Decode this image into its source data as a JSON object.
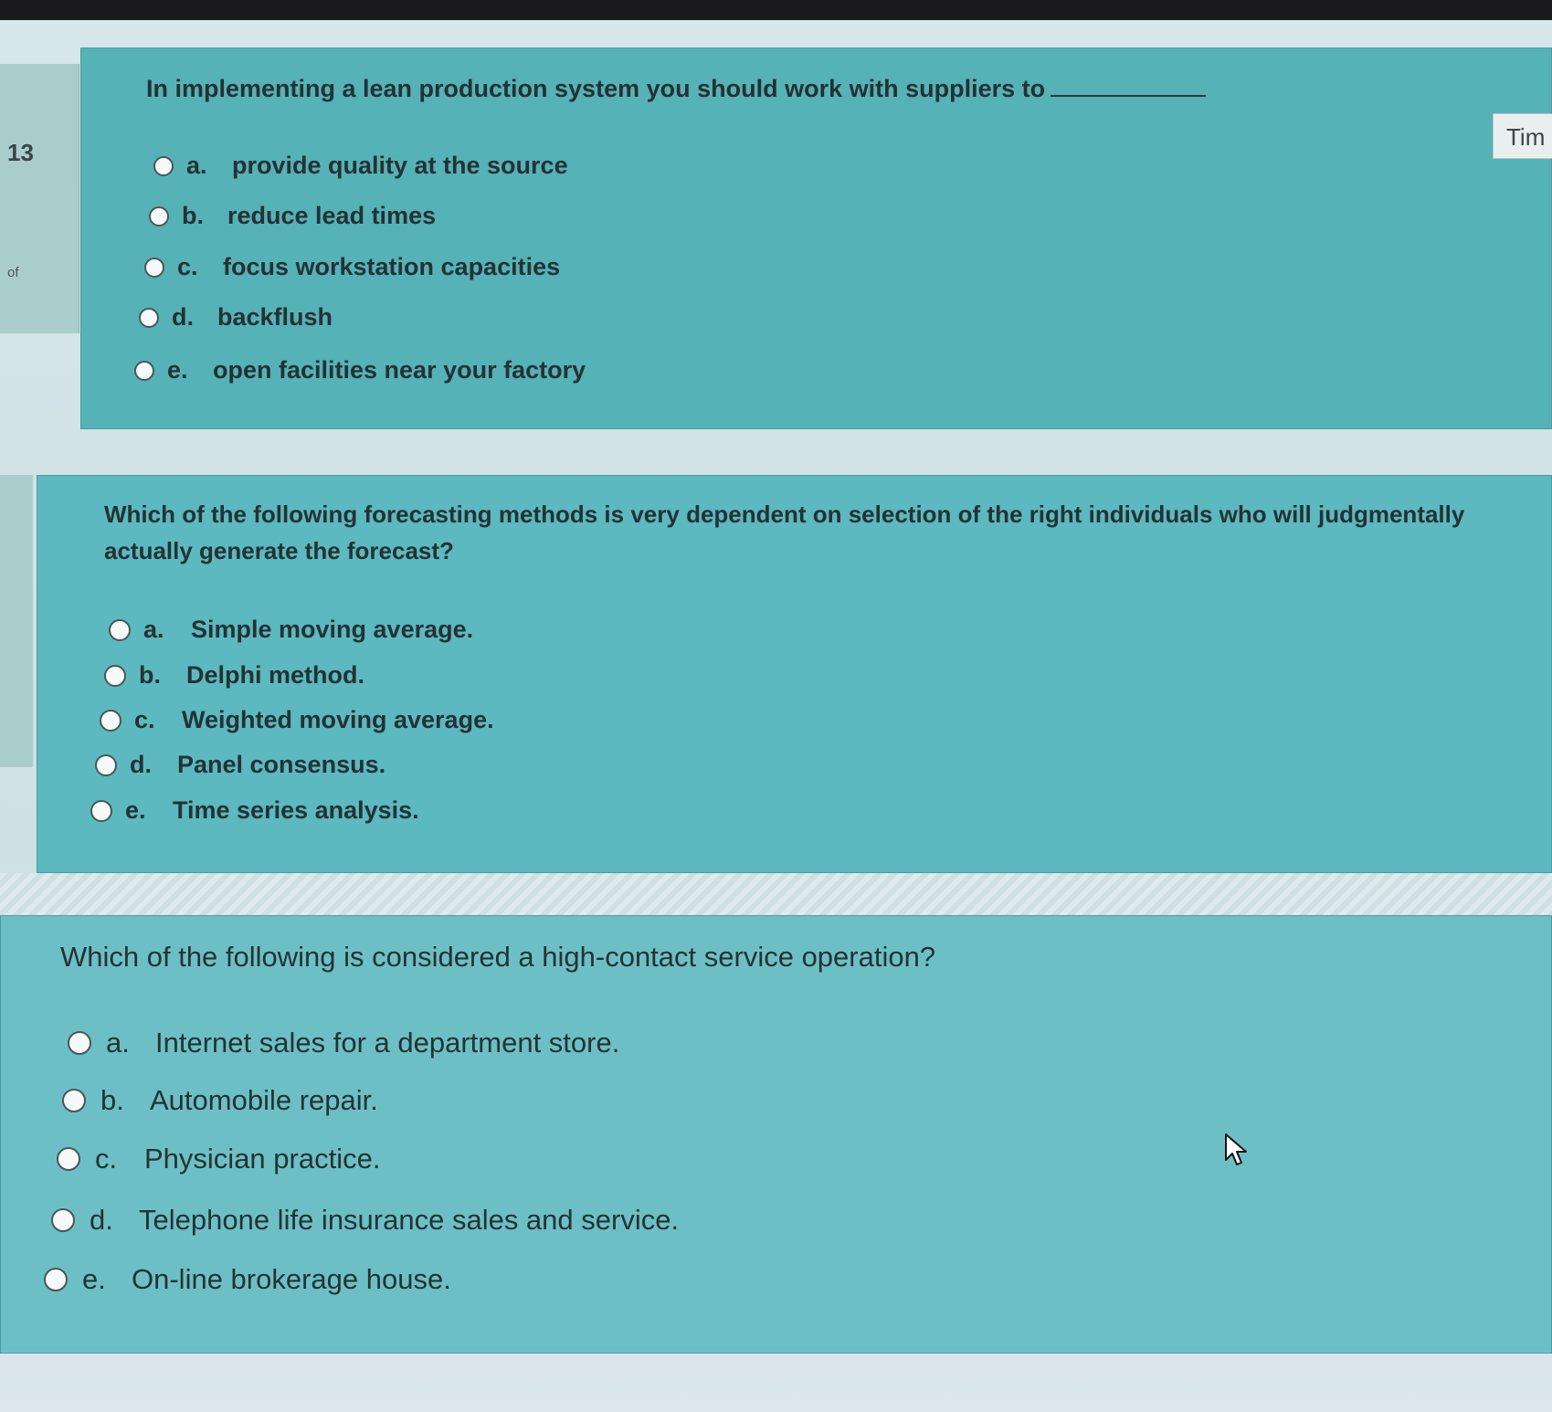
{
  "q1": {
    "number": "13",
    "side_mark": "of",
    "text": "In implementing a lean production system you should work with suppliers to",
    "timer_label": "Tim",
    "options": [
      {
        "letter": "a.",
        "text": "provide quality at the source"
      },
      {
        "letter": "b.",
        "text": "reduce lead times"
      },
      {
        "letter": "c.",
        "text": "focus workstation capacities"
      },
      {
        "letter": "d.",
        "text": "backflush"
      },
      {
        "letter": "e.",
        "text": "open facilities near your factory"
      }
    ]
  },
  "q2": {
    "text_line1": "Which of the following forecasting methods is very dependent on selection of the right individuals who will judgmentally",
    "text_line2": "actually generate the forecast?",
    "options": [
      {
        "letter": "a.",
        "text": "Simple moving average."
      },
      {
        "letter": "b.",
        "text": "Delphi method."
      },
      {
        "letter": "c.",
        "text": "Weighted moving average."
      },
      {
        "letter": "d.",
        "text": "Panel consensus."
      },
      {
        "letter": "e.",
        "text": "Time series analysis."
      }
    ]
  },
  "q3": {
    "text": "Which of the following is considered a high-contact service operation?",
    "options": [
      {
        "letter": "a.",
        "text": "Internet sales for a department store."
      },
      {
        "letter": "b.",
        "text": "Automobile repair."
      },
      {
        "letter": "c.",
        "text": "Physician practice."
      },
      {
        "letter": "d.",
        "text": "Telephone life insurance sales and service."
      },
      {
        "letter": "e.",
        "text": "On-line brokerage house."
      }
    ]
  },
  "icons": {
    "radio": "radio-unselected-icon",
    "cursor": "mouse-pointer-icon"
  }
}
